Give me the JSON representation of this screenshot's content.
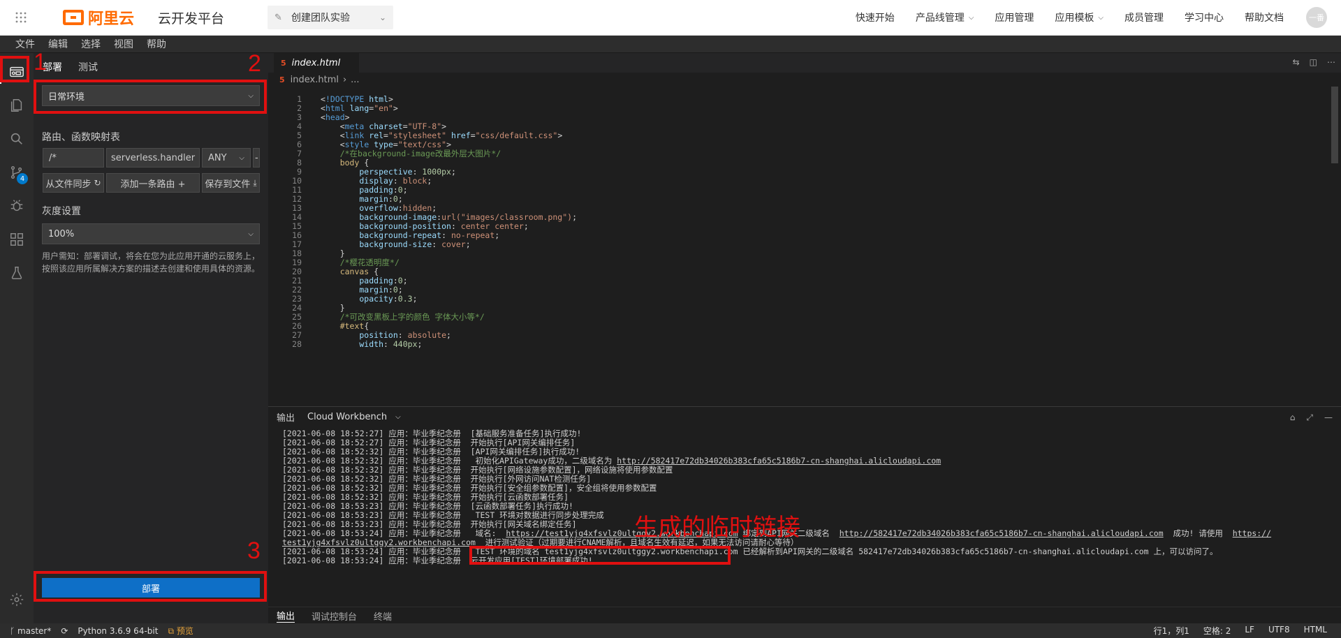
{
  "header": {
    "brand": "阿里云",
    "platform": "云开发平台",
    "team_select": "创建团队实验",
    "nav": [
      {
        "label": "快速开始",
        "dropdown": false
      },
      {
        "label": "产品线管理",
        "dropdown": true
      },
      {
        "label": "应用管理",
        "dropdown": false
      },
      {
        "label": "应用模板",
        "dropdown": true
      },
      {
        "label": "成员管理",
        "dropdown": false
      },
      {
        "label": "学习中心",
        "dropdown": false
      },
      {
        "label": "帮助文档",
        "dropdown": false
      }
    ],
    "avatar": "一番"
  },
  "menubar": [
    "文件",
    "编辑",
    "选择",
    "视图",
    "帮助"
  ],
  "activity": {
    "git_badge": "4"
  },
  "sidebar": {
    "tabs": [
      "部署",
      "测试"
    ],
    "env_select": "日常环境",
    "route_title": "路由、函数映射表",
    "route": {
      "path": "/*",
      "handler": "serverless.handler",
      "method": "ANY",
      "remove": "-"
    },
    "buttons": {
      "sync": "从文件同步",
      "add": "添加一条路由 +",
      "save": "保存到文件"
    },
    "gray_title": "灰度设置",
    "gray_select": "100%",
    "notice": "用户需知：部署调试，将会在您为此应用开通的云服务上，按照该应用所属解决方案的描述去创建和使用具体的资源。",
    "deploy_label": "部署"
  },
  "annotations": {
    "n1": "1",
    "n2": "2",
    "n3": "3",
    "caption": "生成的临时链接"
  },
  "editor": {
    "tab": "index.html",
    "breadcrumb": [
      "index.html",
      "..."
    ],
    "lines": [
      [
        [
          "pun",
          "<"
        ],
        [
          "tag",
          "!DOCTYPE"
        ],
        [
          "pun",
          " "
        ],
        [
          "attr",
          "html"
        ],
        [
          "pun",
          ">"
        ]
      ],
      [
        [
          "pun",
          "<"
        ],
        [
          "tag",
          "html"
        ],
        [
          "pun",
          " "
        ],
        [
          "attr",
          "lang"
        ],
        [
          "pun",
          "="
        ],
        [
          "str",
          "\"en\""
        ],
        [
          "pun",
          ">"
        ]
      ],
      [
        [
          "pun",
          "<"
        ],
        [
          "tag",
          "head"
        ],
        [
          "pun",
          ">"
        ]
      ],
      [
        [
          "pun",
          "    <"
        ],
        [
          "tag",
          "meta"
        ],
        [
          "pun",
          " "
        ],
        [
          "attr",
          "charset"
        ],
        [
          "pun",
          "="
        ],
        [
          "str",
          "\"UTF-8\""
        ],
        [
          "pun",
          ">"
        ]
      ],
      [
        [
          "pun",
          "    <"
        ],
        [
          "tag",
          "link"
        ],
        [
          "pun",
          " "
        ],
        [
          "attr",
          "rel"
        ],
        [
          "pun",
          "="
        ],
        [
          "str",
          "\"stylesheet\""
        ],
        [
          "pun",
          " "
        ],
        [
          "attr",
          "href"
        ],
        [
          "pun",
          "="
        ],
        [
          "str",
          "\"css/default.css\""
        ],
        [
          "pun",
          ">"
        ]
      ],
      [
        [
          "pun",
          "    <"
        ],
        [
          "tag",
          "style"
        ],
        [
          "pun",
          " "
        ],
        [
          "attr",
          "type"
        ],
        [
          "pun",
          "="
        ],
        [
          "str",
          "\"text/css\""
        ],
        [
          "pun",
          ">"
        ]
      ],
      [
        [
          "com",
          "    /*在background-image改最外层大图片*/"
        ]
      ],
      [
        [
          "sel",
          "    body"
        ],
        [
          "pun",
          " {"
        ]
      ],
      [
        [
          "prop",
          "        perspective"
        ],
        [
          "pun",
          ": "
        ],
        [
          "num",
          "1000px"
        ],
        [
          "pun",
          ";"
        ]
      ],
      [
        [
          "prop",
          "        display"
        ],
        [
          "pun",
          ": "
        ],
        [
          "val",
          "block"
        ],
        [
          "pun",
          ";"
        ]
      ],
      [
        [
          "prop",
          "        padding"
        ],
        [
          "pun",
          ":"
        ],
        [
          "num",
          "0"
        ],
        [
          "pun",
          ";"
        ]
      ],
      [
        [
          "prop",
          "        margin"
        ],
        [
          "pun",
          ":"
        ],
        [
          "num",
          "0"
        ],
        [
          "pun",
          ";"
        ]
      ],
      [
        [
          "prop",
          "        overflow"
        ],
        [
          "pun",
          ":"
        ],
        [
          "val",
          "hidden"
        ],
        [
          "pun",
          ";"
        ]
      ],
      [
        [
          "prop",
          "        background-image"
        ],
        [
          "pun",
          ":"
        ],
        [
          "val",
          "url("
        ],
        [
          "str",
          "\"images/classroom.png\""
        ],
        [
          "val",
          ")"
        ],
        [
          "pun",
          ";"
        ]
      ],
      [
        [
          "prop",
          "        background-position"
        ],
        [
          "pun",
          ": "
        ],
        [
          "val",
          "center center"
        ],
        [
          "pun",
          ";"
        ]
      ],
      [
        [
          "prop",
          "        background-repeat"
        ],
        [
          "pun",
          ": "
        ],
        [
          "val",
          "no-repeat"
        ],
        [
          "pun",
          ";"
        ]
      ],
      [
        [
          "prop",
          "        background-size"
        ],
        [
          "pun",
          ": "
        ],
        [
          "val",
          "cover"
        ],
        [
          "pun",
          ";"
        ]
      ],
      [
        [
          "pun",
          "    }"
        ]
      ],
      [
        [
          "com",
          "    /*樱花透明度*/"
        ]
      ],
      [
        [
          "sel",
          "    canvas"
        ],
        [
          "pun",
          " {"
        ]
      ],
      [
        [
          "prop",
          "        padding"
        ],
        [
          "pun",
          ":"
        ],
        [
          "num",
          "0"
        ],
        [
          "pun",
          ";"
        ]
      ],
      [
        [
          "prop",
          "        margin"
        ],
        [
          "pun",
          ":"
        ],
        [
          "num",
          "0"
        ],
        [
          "pun",
          ";"
        ]
      ],
      [
        [
          "prop",
          "        opacity"
        ],
        [
          "pun",
          ":"
        ],
        [
          "num",
          "0.3"
        ],
        [
          "pun",
          ";"
        ]
      ],
      [
        [
          "pun",
          "    }"
        ]
      ],
      [
        [
          "com",
          "    /*可改变黑板上字的颜色 字体大小等*/"
        ]
      ],
      [
        [
          "sel",
          "    #text"
        ],
        [
          "pun",
          "{"
        ]
      ],
      [
        [
          "prop",
          "        position"
        ],
        [
          "pun",
          ": "
        ],
        [
          "val",
          "absolute"
        ],
        [
          "pun",
          ";"
        ]
      ],
      [
        [
          "prop",
          "        width"
        ],
        [
          "pun",
          ": "
        ],
        [
          "num",
          "440px"
        ],
        [
          "pun",
          ";"
        ]
      ]
    ]
  },
  "panel": {
    "label": "输出",
    "channel": "Cloud Workbench",
    "logs": [
      [
        [
          "t",
          "[2021-06-08 18:52:27] 应用：毕业季纪念册  [基础服务准备任务]执行成功!"
        ]
      ],
      [
        [
          "t",
          "[2021-06-08 18:52:27] 应用：毕业季纪念册  开始执行[API网关编排任务]"
        ]
      ],
      [
        [
          "t",
          "[2021-06-08 18:52:32] 应用：毕业季纪念册  [API网关编排任务]执行成功!"
        ]
      ],
      [
        [
          "t",
          "[2021-06-08 18:52:32] 应用：毕业季纪念册   初始化APIGateway成功，二级域名为 "
        ],
        [
          "l",
          "http://582417e72db34026b383cfa65c5186b7-cn-shanghai.alicloudapi.com"
        ]
      ],
      [
        [
          "t",
          "[2021-06-08 18:52:32] 应用：毕业季纪念册  开始执行[网络设施参数配置]，网络设施将使用参数配置"
        ]
      ],
      [
        [
          "t",
          "[2021-06-08 18:52:32] 应用：毕业季纪念册  开始执行[外网访问NAT检测任务]"
        ]
      ],
      [
        [
          "t",
          "[2021-06-08 18:52:32] 应用：毕业季纪念册  开始执行[安全组参数配置]，安全组将使用参数配置"
        ]
      ],
      [
        [
          "t",
          "[2021-06-08 18:52:32] 应用：毕业季纪念册  开始执行[云函数部署任务]"
        ]
      ],
      [
        [
          "t",
          "[2021-06-08 18:53:23] 应用：毕业季纪念册  [云函数部署任务]执行成功!"
        ]
      ],
      [
        [
          "t",
          "[2021-06-08 18:53:23] 应用：毕业季纪念册   TEST 环境对数据进行同步处理完成"
        ]
      ],
      [
        [
          "t",
          "[2021-06-08 18:53:23] 应用：毕业季纪念册  开始执行[网关域名绑定任务]"
        ]
      ],
      [
        [
          "t",
          "[2021-06-08 18:53:24] 应用：毕业季纪念册   域名:  "
        ],
        [
          "l",
          "https://test1yjg4xfsvlz0ultggy2.workbenchapi.com"
        ],
        [
          "t",
          " 绑定到API网关二级域名  "
        ],
        [
          "l",
          "http://582417e72db34026b383cfa65c5186b7-cn-shanghai.alicloudapi.com"
        ],
        [
          "t",
          "  成功! 请使用  "
        ],
        [
          "l",
          "https://"
        ]
      ],
      [
        [
          "l",
          "test1yjg4xfsvlz0ultggy2.workbenchapi.com"
        ],
        [
          "t",
          "  进行测试验证（过期要进行CNAME解析，且域名生效有延迟，如果无法访问请耐心等待）"
        ]
      ],
      [
        [
          "t",
          "[2021-06-08 18:53:24] 应用：毕业季纪念册   TEST 环境的域名 test1yjg4xfsvlz0ultggy2.workbenchapi.com 已经解析到API网关的二级域名 582417e72db34026b383cfa65c5186b7-cn-shanghai.alicloudapi.com 上，可以访问了。"
        ]
      ],
      [
        [
          "t",
          "[2021-06-08 18:53:24] 应用：毕业季纪念册  云开发应用[TEST]环境部署成功!"
        ]
      ]
    ],
    "tabs": [
      "输出",
      "调试控制台",
      "终端"
    ]
  },
  "status": {
    "branch": "master*",
    "python": "Python 3.6.9 64-bit",
    "preview": "预览",
    "position": "行1，列1",
    "spaces": "空格: 2",
    "eol": "LF",
    "encoding": "UTF8",
    "language": "HTML"
  },
  "colors": {
    "accent": "#ff6a00",
    "annotation": "#e01010",
    "deploy_button": "#0e6fc7"
  }
}
